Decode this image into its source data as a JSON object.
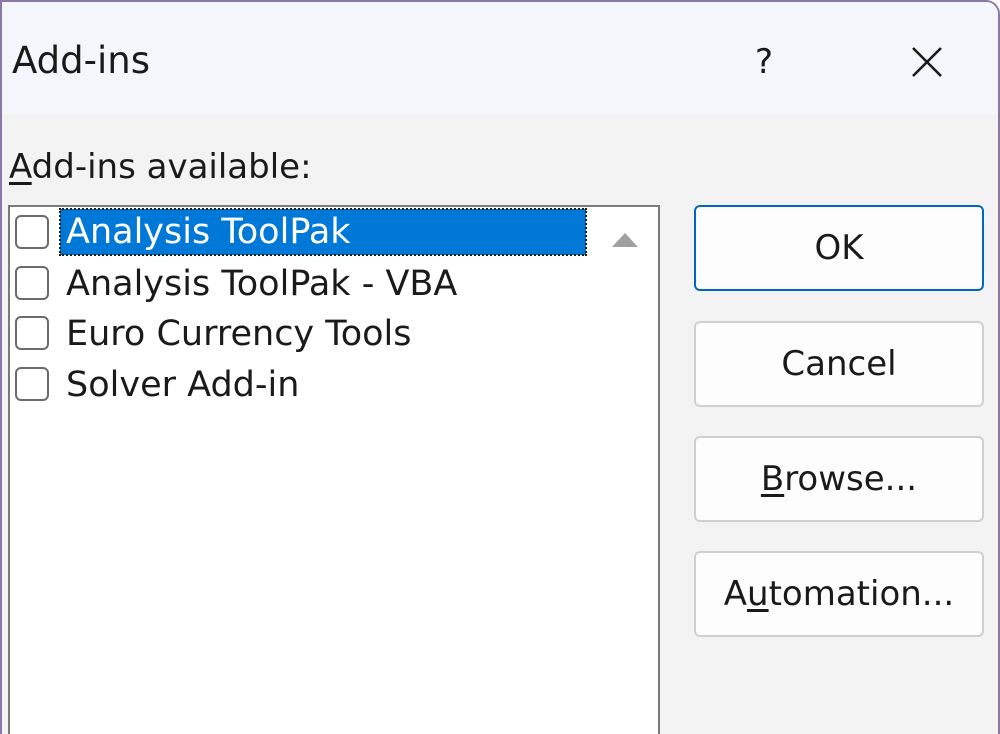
{
  "dialog": {
    "title": "Add-ins",
    "help_label": "?"
  },
  "list": {
    "label_accel": "A",
    "label_rest": "dd-ins available:",
    "items": [
      {
        "label": "Analysis ToolPak",
        "checked": false,
        "selected": true
      },
      {
        "label": "Analysis ToolPak - VBA",
        "checked": false,
        "selected": false
      },
      {
        "label": "Euro Currency Tools",
        "checked": false,
        "selected": false
      },
      {
        "label": "Solver Add-in",
        "checked": false,
        "selected": false
      }
    ]
  },
  "buttons": {
    "ok": "OK",
    "cancel": "Cancel",
    "browse_accel": "B",
    "browse_rest": "rowse...",
    "automation_pre": "A",
    "automation_accel": "u",
    "automation_rest": "tomation..."
  },
  "colors": {
    "selection": "#0078d7",
    "primary_border": "#0067c0",
    "window_border": "#8a79a8"
  }
}
